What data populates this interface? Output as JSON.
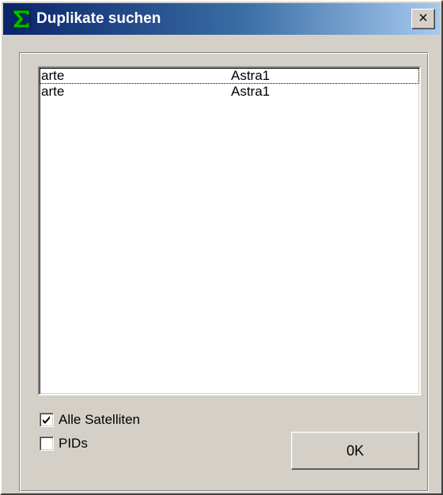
{
  "window": {
    "title": "Duplikate suchen",
    "close_glyph": "×",
    "icon": "sigma-app-icon"
  },
  "colors": {
    "titlebar_start": "#0a246a",
    "titlebar_end": "#a6caf0",
    "face": "#d4d0c8"
  },
  "duplicates": {
    "rows": [
      {
        "name": "arte",
        "satellite": "Astra1",
        "focused": true
      },
      {
        "name": "arte",
        "satellite": "Astra1",
        "focused": false
      }
    ]
  },
  "options": {
    "all_satellites": {
      "label": "Alle Satelliten",
      "checked": true
    },
    "pids": {
      "label": "PIDs",
      "checked": false
    }
  },
  "buttons": {
    "ok_label": "0K"
  }
}
